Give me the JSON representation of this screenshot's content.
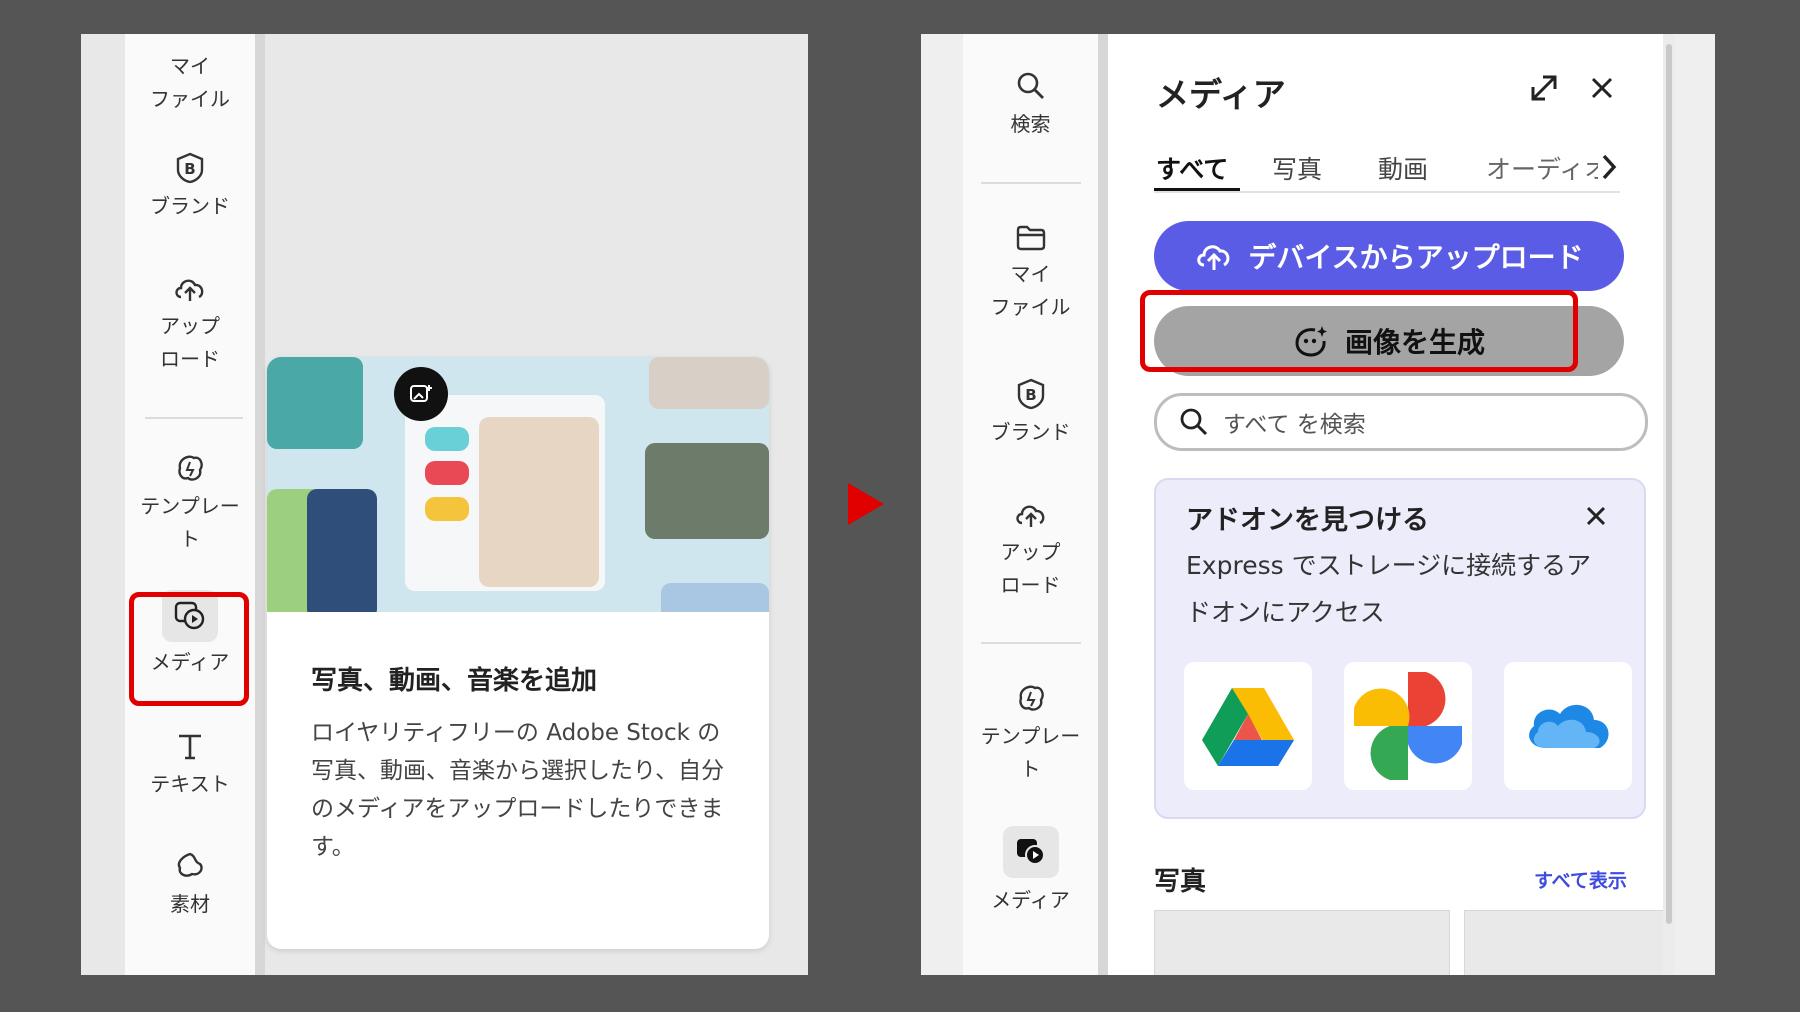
{
  "left_panel": {
    "rail": {
      "items": [
        {
          "label": "マイ\nファイル",
          "icon": "folder-icon"
        },
        {
          "label": "ブランド",
          "icon": "brand-icon"
        },
        {
          "label": "アップ\nロード",
          "icon": "cloud-upload-icon"
        },
        {
          "label": "テンプレー\nト",
          "icon": "template-icon"
        },
        {
          "label": "メディア",
          "icon": "media-icon"
        },
        {
          "label": "テキスト",
          "icon": "text-icon"
        },
        {
          "label": "素材",
          "icon": "elements-icon"
        }
      ]
    },
    "card": {
      "title": "写真、動画、音楽を追加",
      "description": "ロイヤリティフリーの Adobe Stock の写真、動画、音楽から選択したり、自分のメディアをアップロードしたりできます。"
    }
  },
  "right_panel": {
    "rail": {
      "items": [
        {
          "label": "検索",
          "icon": "search-icon"
        },
        {
          "label": "マイ\nファイル",
          "icon": "folder-icon"
        },
        {
          "label": "ブランド",
          "icon": "brand-icon"
        },
        {
          "label": "アップ\nロード",
          "icon": "cloud-upload-icon"
        },
        {
          "label": "テンプレー\nト",
          "icon": "template-icon"
        },
        {
          "label": "メディア",
          "icon": "media-icon"
        }
      ]
    },
    "pane": {
      "title": "メディア",
      "tabs": [
        "すべて",
        "写真",
        "動画",
        "オーディオ"
      ],
      "active_tab": "すべて",
      "upload_button": "デバイスからアップロード",
      "generate_button": "画像を生成",
      "search_placeholder": "すべて を検索",
      "addon": {
        "title": "アドオンを見つける",
        "description": "Express でストレージに接続するアドオンにアクセス",
        "services": [
          "google-drive-icon",
          "google-photos-icon",
          "onedrive-icon"
        ]
      },
      "photos_section": {
        "label": "写真",
        "show_all": "すべて表示"
      }
    }
  },
  "colors": {
    "background": "#555555",
    "accent_red": "#e00000",
    "upload_blue": "#5b5ce6",
    "link_blue": "#3d4ae0"
  }
}
